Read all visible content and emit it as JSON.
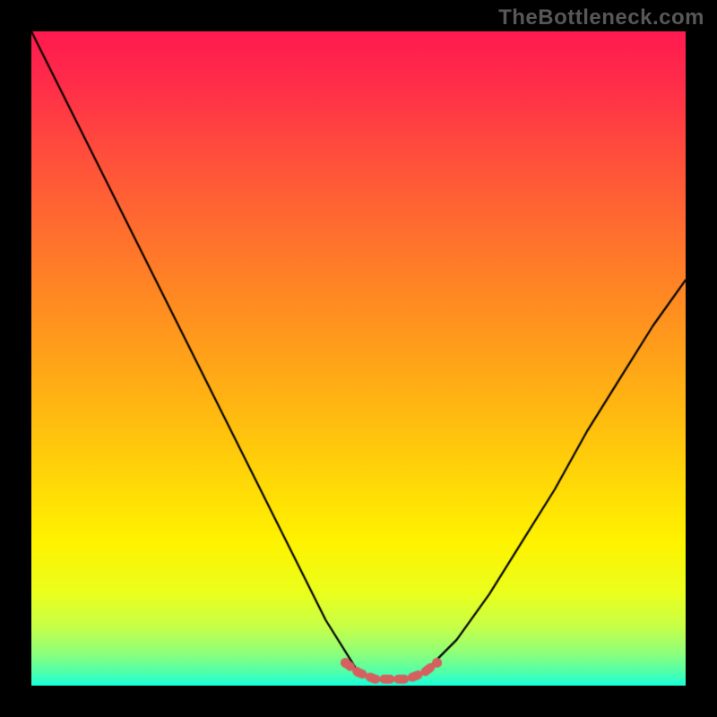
{
  "watermark": "TheBottleneck.com",
  "chart_data": {
    "type": "line",
    "title": "",
    "xlabel": "",
    "ylabel": "",
    "xlim": [
      0,
      1
    ],
    "ylim": [
      0,
      1
    ],
    "series": [
      {
        "name": "curve",
        "x": [
          0.0,
          0.05,
          0.1,
          0.15,
          0.2,
          0.25,
          0.3,
          0.35,
          0.4,
          0.45,
          0.5,
          0.525,
          0.55,
          0.575,
          0.6,
          0.65,
          0.7,
          0.75,
          0.8,
          0.85,
          0.9,
          0.95,
          1.0
        ],
        "y": [
          1.0,
          0.9,
          0.8,
          0.7,
          0.6,
          0.5,
          0.4,
          0.3,
          0.2,
          0.1,
          0.02,
          0.01,
          0.01,
          0.01,
          0.02,
          0.07,
          0.14,
          0.22,
          0.3,
          0.39,
          0.47,
          0.55,
          0.62
        ]
      },
      {
        "name": "bottom-highlight",
        "x": [
          0.48,
          0.5,
          0.525,
          0.55,
          0.575,
          0.6,
          0.62
        ],
        "y": [
          0.035,
          0.02,
          0.01,
          0.01,
          0.01,
          0.02,
          0.035
        ]
      }
    ],
    "gradient_stops": [
      {
        "offset": 0.0,
        "color": "#ff1a50"
      },
      {
        "offset": 0.08,
        "color": "#ff2d49"
      },
      {
        "offset": 0.18,
        "color": "#ff4c3d"
      },
      {
        "offset": 0.3,
        "color": "#ff6d2f"
      },
      {
        "offset": 0.42,
        "color": "#ff8d21"
      },
      {
        "offset": 0.55,
        "color": "#ffb014"
      },
      {
        "offset": 0.68,
        "color": "#ffd608"
      },
      {
        "offset": 0.78,
        "color": "#fff300"
      },
      {
        "offset": 0.86,
        "color": "#eaff1e"
      },
      {
        "offset": 0.91,
        "color": "#c7ff48"
      },
      {
        "offset": 0.95,
        "color": "#8fff7a"
      },
      {
        "offset": 0.98,
        "color": "#4fffac"
      },
      {
        "offset": 1.0,
        "color": "#18ffda"
      }
    ],
    "colors": {
      "curve": "#000000",
      "highlight": "#d56060",
      "frame": "#000000"
    }
  }
}
